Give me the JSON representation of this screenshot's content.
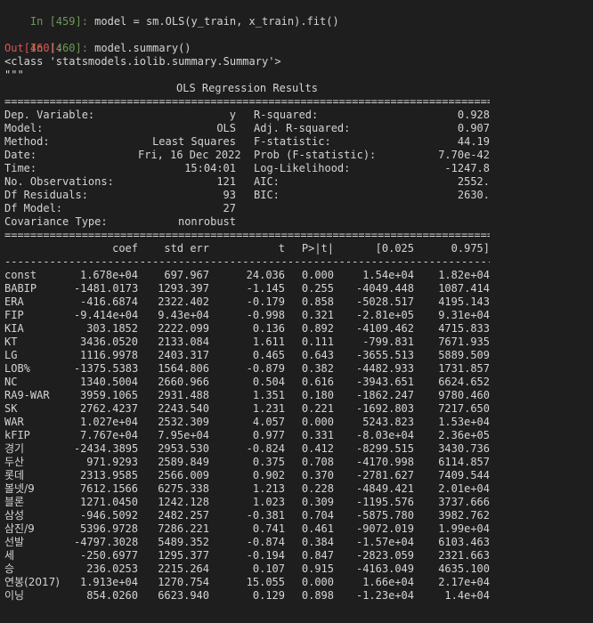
{
  "cells": {
    "in459": {
      "prompt": "In [459]:",
      "code": " model = sm.OLS(y_train, x_train).fit()"
    },
    "in460": {
      "prompt": "In [460]:",
      "code": " model.summary()"
    },
    "out460": {
      "prompt": "Out[460]:"
    }
  },
  "output": {
    "class_line": "<class 'statsmodels.iolib.summary.Summary'>",
    "quotes": "\"\"\"",
    "title": "OLS Regression Results",
    "double_rule": "==============================================================================",
    "single_rule": "------------------------------------------------------------------------------"
  },
  "header": {
    "left": [
      {
        "label": "Dep. Variable:",
        "value": "y"
      },
      {
        "label": "Model:",
        "value": "OLS"
      },
      {
        "label": "Method:",
        "value": "Least Squares"
      },
      {
        "label": "Date:",
        "value": "Fri, 16 Dec 2022"
      },
      {
        "label": "Time:",
        "value": "15:04:01"
      },
      {
        "label": "No. Observations:",
        "value": "121"
      },
      {
        "label": "Df Residuals:",
        "value": "93"
      },
      {
        "label": "Df Model:",
        "value": "27"
      },
      {
        "label": "Covariance Type:",
        "value": "nonrobust"
      }
    ],
    "right": [
      {
        "label": "R-squared:",
        "value": "0.928"
      },
      {
        "label": "Adj. R-squared:",
        "value": "0.907"
      },
      {
        "label": "F-statistic:",
        "value": "44.19"
      },
      {
        "label": "Prob (F-statistic):",
        "value": "7.70e-42"
      },
      {
        "label": "Log-Likelihood:",
        "value": "-1247.8"
      },
      {
        "label": "AIC:",
        "value": "2552."
      },
      {
        "label": "BIC:",
        "value": "2630."
      },
      {
        "label": "",
        "value": ""
      },
      {
        "label": "",
        "value": ""
      }
    ]
  },
  "columns": [
    "",
    "coef",
    "std err",
    "t",
    "P>|t|",
    "[0.025",
    "0.975]"
  ],
  "rows": [
    [
      "const",
      "1.678e+04",
      "697.967",
      "24.036",
      "0.000",
      "1.54e+04",
      "1.82e+04"
    ],
    [
      "BABIP",
      "-1481.0173",
      "1293.397",
      "-1.145",
      "0.255",
      "-4049.448",
      "1087.414"
    ],
    [
      "ERA",
      "-416.6874",
      "2322.402",
      "-0.179",
      "0.858",
      "-5028.517",
      "4195.143"
    ],
    [
      "FIP",
      "-9.414e+04",
      "9.43e+04",
      "-0.998",
      "0.321",
      "-2.81e+05",
      "9.31e+04"
    ],
    [
      "KIA",
      "303.1852",
      "2222.099",
      "0.136",
      "0.892",
      "-4109.462",
      "4715.833"
    ],
    [
      "KT",
      "3436.0520",
      "2133.084",
      "1.611",
      "0.111",
      "-799.831",
      "7671.935"
    ],
    [
      "LG",
      "1116.9978",
      "2403.317",
      "0.465",
      "0.643",
      "-3655.513",
      "5889.509"
    ],
    [
      "LOB%",
      "-1375.5383",
      "1564.806",
      "-0.879",
      "0.382",
      "-4482.933",
      "1731.857"
    ],
    [
      "NC",
      "1340.5004",
      "2660.966",
      "0.504",
      "0.616",
      "-3943.651",
      "6624.652"
    ],
    [
      "RA9-WAR",
      "3959.1065",
      "2931.488",
      "1.351",
      "0.180",
      "-1862.247",
      "9780.460"
    ],
    [
      "SK",
      "2762.4237",
      "2243.540",
      "1.231",
      "0.221",
      "-1692.803",
      "7217.650"
    ],
    [
      "WAR",
      "1.027e+04",
      "2532.309",
      "4.057",
      "0.000",
      "5243.823",
      "1.53e+04"
    ],
    [
      "kFIP",
      "7.767e+04",
      "7.95e+04",
      "0.977",
      "0.331",
      "-8.03e+04",
      "2.36e+05"
    ],
    [
      "경기",
      "-2434.3895",
      "2953.530",
      "-0.824",
      "0.412",
      "-8299.515",
      "3430.736"
    ],
    [
      "두산",
      "971.9293",
      "2589.849",
      "0.375",
      "0.708",
      "-4170.998",
      "6114.857"
    ],
    [
      "롯데",
      "2313.9585",
      "2566.009",
      "0.902",
      "0.370",
      "-2781.627",
      "7409.544"
    ],
    [
      "볼넷/9",
      "7612.1566",
      "6275.338",
      "1.213",
      "0.228",
      "-4849.421",
      "2.01e+04"
    ],
    [
      "블론",
      "1271.0450",
      "1242.128",
      "1.023",
      "0.309",
      "-1195.576",
      "3737.666"
    ],
    [
      "삼성",
      "-946.5092",
      "2482.257",
      "-0.381",
      "0.704",
      "-5875.780",
      "3982.762"
    ],
    [
      "삼진/9",
      "5396.9728",
      "7286.221",
      "0.741",
      "0.461",
      "-9072.019",
      "1.99e+04"
    ],
    [
      "선발",
      "-4797.3028",
      "5489.352",
      "-0.874",
      "0.384",
      "-1.57e+04",
      "6103.463"
    ],
    [
      "세",
      "-250.6977",
      "1295.377",
      "-0.194",
      "0.847",
      "-2823.059",
      "2321.663"
    ],
    [
      "승",
      "236.0253",
      "2215.264",
      "0.107",
      "0.915",
      "-4163.049",
      "4635.100"
    ],
    [
      "연봉(2017)",
      "1.913e+04",
      "1270.754",
      "15.055",
      "0.000",
      "1.66e+04",
      "2.17e+04"
    ],
    [
      "이닝",
      "854.0260",
      "6623.940",
      "0.129",
      "0.898",
      "-1.23e+04",
      "1.4e+04"
    ]
  ]
}
